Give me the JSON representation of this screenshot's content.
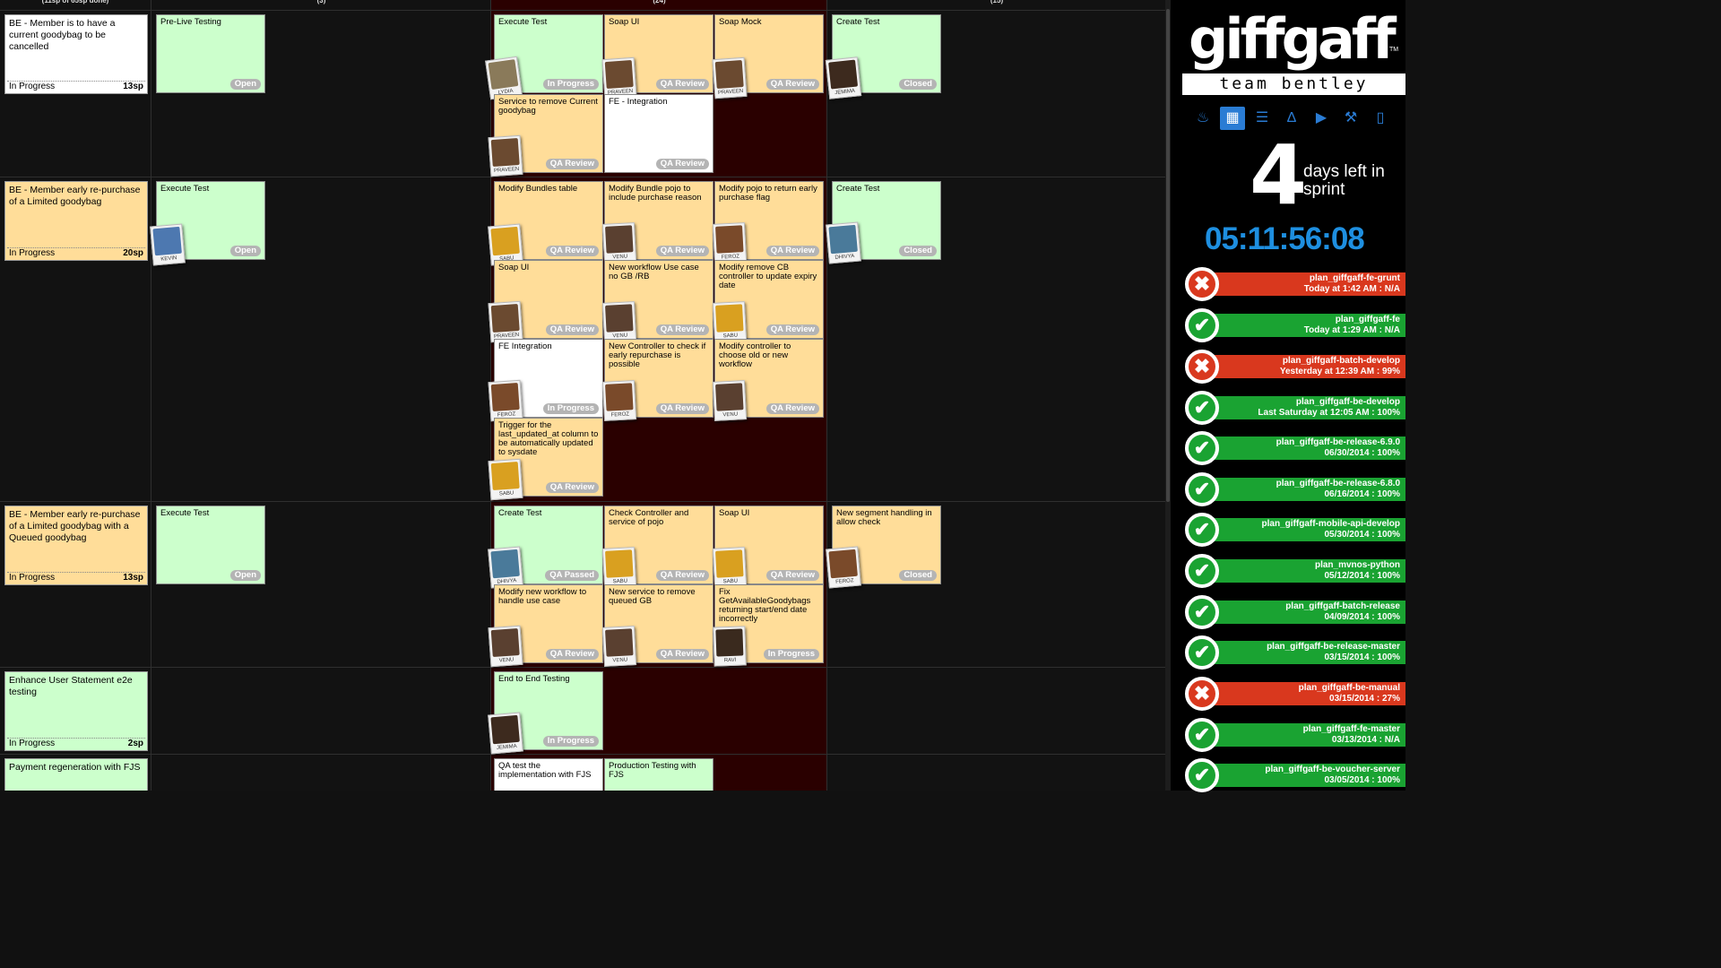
{
  "board": {
    "column_headers": [
      "(11sp of 65sp done)",
      "(3)",
      "(24)",
      "(15)"
    ],
    "rows": [
      {
        "story": {
          "title": "BE - Member is to have a current goodybag to be cancelled",
          "status": "In Progress",
          "points": "13sp",
          "color": "white"
        },
        "cards": [
          {
            "title": "Pre-Live Testing",
            "status": "Open",
            "color": "green"
          },
          {
            "title": "Execute Test",
            "status": "In Progress",
            "color": "green",
            "avatar": "LYDIA"
          },
          {
            "title": "Soap UI",
            "status": "QA Review",
            "color": "orange",
            "avatar": "PRAVEEN"
          },
          {
            "title": "Soap Mock",
            "status": "QA Review",
            "color": "orange",
            "avatar": "PRAVEEN"
          },
          {
            "title": "Create Test",
            "status": "Closed",
            "color": "green",
            "avatar": "JEMIMA"
          },
          {
            "title": "Service to remove Current goodybag",
            "status": "QA Review",
            "color": "orange",
            "avatar": "PRAVEEN"
          },
          {
            "title": "FE - Integration",
            "status": "QA Review",
            "color": "white"
          }
        ]
      },
      {
        "story": {
          "title": "BE - Member early re-purchase of a Limited goodybag",
          "status": "In Progress",
          "points": "20sp",
          "color": "orange"
        },
        "cards": [
          {
            "title": "Execute Test",
            "status": "Open",
            "color": "green",
            "avatar": "KEVIN"
          },
          {
            "title": "Modify Bundles table",
            "status": "QA Review",
            "color": "orange",
            "avatar": "SABU"
          },
          {
            "title": "Modify Bundle pojo to include purchase reason",
            "status": "QA Review",
            "color": "orange",
            "avatar": "VENU"
          },
          {
            "title": "Modify pojo to return early purchase flag",
            "status": "QA Review",
            "color": "orange",
            "avatar": "FEROZ"
          },
          {
            "title": "Create Test",
            "status": "Closed",
            "color": "green",
            "avatar": "DHIVYA"
          },
          {
            "title": "Soap UI",
            "status": "QA Review",
            "color": "orange",
            "avatar": "PRAVEEN"
          },
          {
            "title": "New workflow Use case no GB /RB",
            "status": "QA Review",
            "color": "orange",
            "avatar": "VENU"
          },
          {
            "title": "Modify remove CB controller to update expiry date",
            "status": "QA Review",
            "color": "orange",
            "avatar": "SABU"
          },
          {
            "title": "FE Integration",
            "status": "In Progress",
            "color": "white",
            "avatar": "FEROZ"
          },
          {
            "title": "New Controller to check if early repurchase is possible",
            "status": "QA Review",
            "color": "orange",
            "avatar": "FEROZ"
          },
          {
            "title": "Modify controller to choose old or new workflow",
            "status": "QA Review",
            "color": "orange",
            "avatar": "VENU"
          },
          {
            "title": "Trigger for the last_updated_at column to be automatically updated to sysdate",
            "status": "QA Review",
            "color": "orange",
            "avatar": "SABU"
          }
        ]
      },
      {
        "story": {
          "title": "BE - Member early re-purchase of a Limited goodybag with a Queued goodybag",
          "status": "In Progress",
          "points": "13sp",
          "color": "orange"
        },
        "cards": [
          {
            "title": "Execute Test",
            "status": "Open",
            "color": "green"
          },
          {
            "title": "Create Test",
            "status": "QA Passed",
            "color": "green",
            "avatar": "DHIVYA"
          },
          {
            "title": "Check Controller and service of pojo",
            "status": "QA Review",
            "color": "orange",
            "avatar": "SABU"
          },
          {
            "title": "Soap UI",
            "status": "QA Review",
            "color": "orange",
            "avatar": "SABU"
          },
          {
            "title": "New segment handling in allow check",
            "status": "Closed",
            "color": "orange",
            "avatar": "FEROZ"
          },
          {
            "title": "Modify new workflow to handle use case",
            "status": "QA Review",
            "color": "orange",
            "avatar": "VENU"
          },
          {
            "title": "New service to remove queued GB",
            "status": "QA Review",
            "color": "orange",
            "avatar": "VENU"
          },
          {
            "title": "Fix GetAvailableGoodybags returning start/end date incorrectly",
            "status": "In Progress",
            "color": "orange",
            "avatar": "RAVI"
          }
        ]
      },
      {
        "story": {
          "title": "Enhance User Statement e2e testing",
          "status": "In Progress",
          "points": "2sp",
          "color": "green"
        },
        "cards": [
          {
            "title": "End to End Testing",
            "status": "In Progress",
            "color": "green",
            "avatar": "JEMIMA"
          }
        ]
      },
      {
        "story": {
          "title": "Payment regeneration with FJS",
          "status": "",
          "points": "",
          "color": "green"
        },
        "cards": [
          {
            "title": "QA test the implementation with FJS",
            "status": "",
            "color": "white"
          },
          {
            "title": "Production Testing with FJS",
            "status": "",
            "color": "green"
          }
        ]
      }
    ]
  },
  "sidebar": {
    "logo": "giffgaff",
    "logo_tm": "TM",
    "team": "team bentley",
    "tools": [
      "flame-icon",
      "grid-icon",
      "list-icon",
      "road-icon",
      "play-icon",
      "wrench-icon",
      "book-icon"
    ],
    "days_left": "4",
    "days_label": "days left in sprint",
    "timer": "05:11:56:08",
    "builds": [
      {
        "name": "plan_giffgaff-fe-grunt",
        "detail": "Today at 1:42 AM : N/A",
        "status": "fail"
      },
      {
        "name": "plan_giffgaff-fe",
        "detail": "Today at 1:29 AM : N/A",
        "status": "pass"
      },
      {
        "name": "plan_giffgaff-batch-develop",
        "detail": "Yesterday at 12:39 AM : 99%",
        "status": "fail"
      },
      {
        "name": "plan_giffgaff-be-develop",
        "detail": "Last Saturday at 12:05 AM : 100%",
        "status": "pass"
      },
      {
        "name": "plan_giffgaff-be-release-6.9.0",
        "detail": "06/30/2014 : 100%",
        "status": "pass"
      },
      {
        "name": "plan_giffgaff-be-release-6.8.0",
        "detail": "06/16/2014 : 100%",
        "status": "pass"
      },
      {
        "name": "plan_giffgaff-mobile-api-develop",
        "detail": "05/30/2014 : 100%",
        "status": "pass"
      },
      {
        "name": "plan_mvnos-python",
        "detail": "05/12/2014 : 100%",
        "status": "pass"
      },
      {
        "name": "plan_giffgaff-batch-release",
        "detail": "04/09/2014 : 100%",
        "status": "pass"
      },
      {
        "name": "plan_giffgaff-be-release-master",
        "detail": "03/15/2014 : 100%",
        "status": "pass"
      },
      {
        "name": "plan_giffgaff-be-manual",
        "detail": "03/15/2014 : 27%",
        "status": "fail"
      },
      {
        "name": "plan_giffgaff-fe-master",
        "detail": "03/13/2014 : N/A",
        "status": "pass"
      },
      {
        "name": "plan_giffgaff-be-voucher-server",
        "detail": "03/05/2014 : 100%",
        "status": "pass"
      }
    ],
    "colors": {
      "pass": "#1aa332",
      "fail": "#d9381e",
      "accent": "#1e8fe0"
    }
  }
}
